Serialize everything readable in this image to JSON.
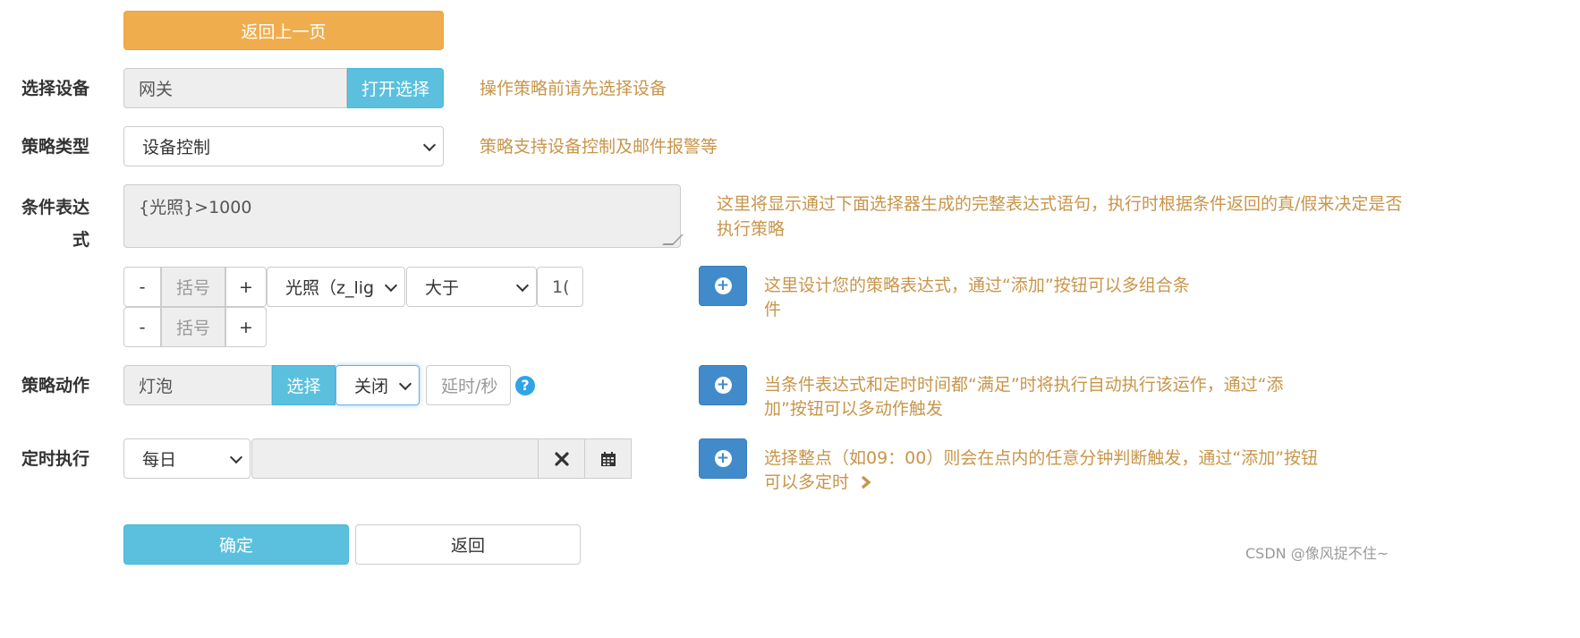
{
  "top": {
    "back_label": "返回上一页"
  },
  "device": {
    "label": "选择设备",
    "value": "网关",
    "open_button": "打开选择",
    "hint": "操作策略前请先选择设备"
  },
  "strategy_type": {
    "label": "策略类型",
    "selected": "设备控制",
    "hint": "策略支持设备控制及邮件报警等"
  },
  "condition": {
    "label_line1": "条件表达",
    "label_line2": "式",
    "expression": "{光照}>1000",
    "hint_line1": "这里将显示通过下面选择器生成的完整表达式语句，执行时根据条件返回的真/假来决定是否",
    "hint_line2": "执行策略"
  },
  "builder": {
    "minus": "-",
    "plus": "+",
    "paren_placeholder": "括号",
    "field_selected": "光照（z_lig",
    "operator_selected": "大于",
    "value_partial": "1(",
    "hint_line1": "这里设计您的策略表达式，通过“添加”按钮可以多组合条",
    "hint_line2": "件"
  },
  "action": {
    "label": "策略动作",
    "device_value": "灯泡",
    "select_button": "选择",
    "state_selected": "关闭",
    "delay_placeholder": "延时/秒",
    "help_icon": "?",
    "hint_line1": "当条件表达式和定时时间都“满足”时将执行自动执行该运作，通过“添",
    "hint_line2": "加”按钮可以多动作触发"
  },
  "schedule": {
    "label": "定时执行",
    "frequency_selected": "每日",
    "time_value": "",
    "hint_line1": "选择整点（如09：00）则会在点内的任意分钟判断触发，通过“添加”按钮",
    "hint_line2": "可以多定时"
  },
  "footer": {
    "confirm_label": "确定",
    "back_label": "返回"
  },
  "watermark": "CSDN @像风捉不住~",
  "colors": {
    "accent_orange": "#f0ad4e",
    "info_blue": "#5bc0de",
    "primary_blue": "#428bca",
    "hint_text": "#c8954a"
  }
}
